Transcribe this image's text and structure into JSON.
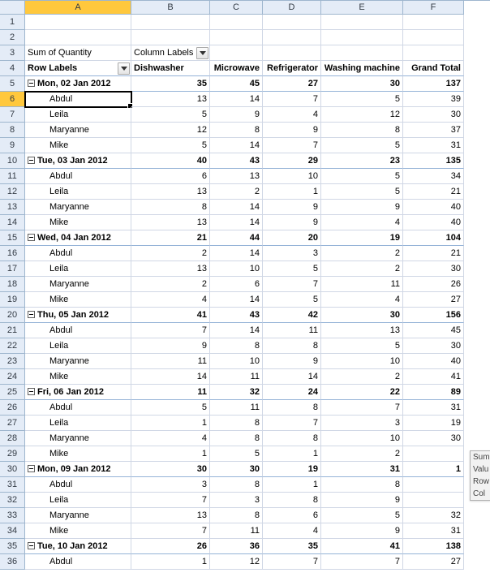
{
  "columns": [
    "A",
    "B",
    "C",
    "D",
    "E",
    "F"
  ],
  "row3": {
    "A": "Sum of Quantity",
    "B": "Column Labels"
  },
  "row4": {
    "A": "Row Labels",
    "B": "Dishwasher",
    "C": "Microwave",
    "D": "Refrigerator",
    "E": "Washing machine",
    "F": "Grand Total"
  },
  "groups": [
    {
      "label": "Mon, 02 Jan 2012",
      "B": 35,
      "C": 45,
      "D": 27,
      "E": 30,
      "F": 137,
      "rows": [
        {
          "name": "Abdul",
          "B": 13,
          "C": 14,
          "D": 7,
          "E": 5,
          "F": 39
        },
        {
          "name": "Leila",
          "B": 5,
          "C": 9,
          "D": 4,
          "E": 12,
          "F": 30
        },
        {
          "name": "Maryanne",
          "B": 12,
          "C": 8,
          "D": 9,
          "E": 8,
          "F": 37
        },
        {
          "name": "Mike",
          "B": 5,
          "C": 14,
          "D": 7,
          "E": 5,
          "F": 31
        }
      ]
    },
    {
      "label": "Tue, 03 Jan 2012",
      "B": 40,
      "C": 43,
      "D": 29,
      "E": 23,
      "F": 135,
      "rows": [
        {
          "name": "Abdul",
          "B": 6,
          "C": 13,
          "D": 10,
          "E": 5,
          "F": 34
        },
        {
          "name": "Leila",
          "B": 13,
          "C": 2,
          "D": 1,
          "E": 5,
          "F": 21
        },
        {
          "name": "Maryanne",
          "B": 8,
          "C": 14,
          "D": 9,
          "E": 9,
          "F": 40
        },
        {
          "name": "Mike",
          "B": 13,
          "C": 14,
          "D": 9,
          "E": 4,
          "F": 40
        }
      ]
    },
    {
      "label": "Wed, 04 Jan 2012",
      "B": 21,
      "C": 44,
      "D": 20,
      "E": 19,
      "F": 104,
      "rows": [
        {
          "name": "Abdul",
          "B": 2,
          "C": 14,
          "D": 3,
          "E": 2,
          "F": 21
        },
        {
          "name": "Leila",
          "B": 13,
          "C": 10,
          "D": 5,
          "E": 2,
          "F": 30
        },
        {
          "name": "Maryanne",
          "B": 2,
          "C": 6,
          "D": 7,
          "E": 11,
          "F": 26
        },
        {
          "name": "Mike",
          "B": 4,
          "C": 14,
          "D": 5,
          "E": 4,
          "F": 27
        }
      ]
    },
    {
      "label": "Thu, 05 Jan 2012",
      "B": 41,
      "C": 43,
      "D": 42,
      "E": 30,
      "F": 156,
      "rows": [
        {
          "name": "Abdul",
          "B": 7,
          "C": 14,
          "D": 11,
          "E": 13,
          "F": 45
        },
        {
          "name": "Leila",
          "B": 9,
          "C": 8,
          "D": 8,
          "E": 5,
          "F": 30
        },
        {
          "name": "Maryanne",
          "B": 11,
          "C": 10,
          "D": 9,
          "E": 10,
          "F": 40
        },
        {
          "name": "Mike",
          "B": 14,
          "C": 11,
          "D": 14,
          "E": 2,
          "F": 41
        }
      ]
    },
    {
      "label": "Fri, 06 Jan 2012",
      "B": 11,
      "C": 32,
      "D": 24,
      "E": 22,
      "F": 89,
      "rows": [
        {
          "name": "Abdul",
          "B": 5,
          "C": 11,
          "D": 8,
          "E": 7,
          "F": 31
        },
        {
          "name": "Leila",
          "B": 1,
          "C": 8,
          "D": 7,
          "E": 3,
          "F": 19
        },
        {
          "name": "Maryanne",
          "B": 4,
          "C": 8,
          "D": 8,
          "E": 10,
          "F": 30
        },
        {
          "name": "Mike",
          "B": 1,
          "C": 5,
          "D": 1,
          "E": 2,
          "F": ""
        }
      ]
    },
    {
      "label": "Mon, 09 Jan 2012",
      "B": 30,
      "C": 30,
      "D": 19,
      "E": 31,
      "F": "1",
      "rows": [
        {
          "name": "Abdul",
          "B": 3,
          "C": 8,
          "D": 1,
          "E": 8,
          "F": ""
        },
        {
          "name": "Leila",
          "B": 7,
          "C": 3,
          "D": 8,
          "E": 9,
          "F": ""
        },
        {
          "name": "Maryanne",
          "B": 13,
          "C": 8,
          "D": 6,
          "E": 5,
          "F": 32
        },
        {
          "name": "Mike",
          "B": 7,
          "C": 11,
          "D": 4,
          "E": 9,
          "F": 31
        }
      ]
    },
    {
      "label": "Tue, 10 Jan 2012",
      "B": 26,
      "C": 36,
      "D": 35,
      "E": 41,
      "F": 138,
      "rows": [
        {
          "name": "Abdul",
          "B": 1,
          "C": 12,
          "D": 7,
          "E": 7,
          "F": 27
        }
      ]
    }
  ],
  "float": [
    "Sum",
    "Valu",
    "Row",
    "Col"
  ]
}
